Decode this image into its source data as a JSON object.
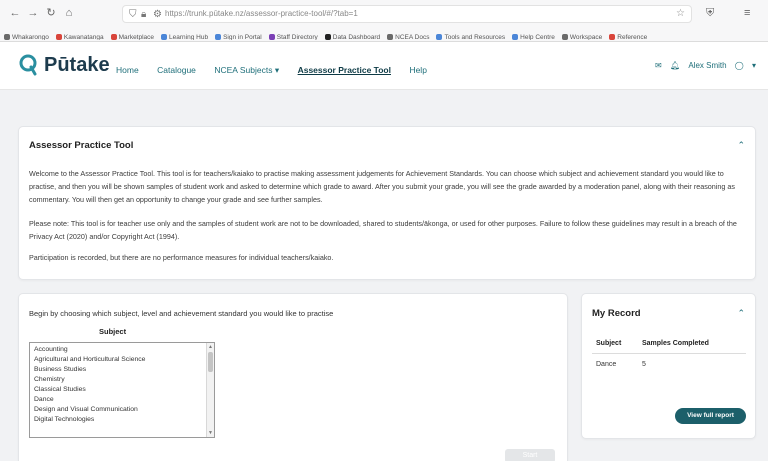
{
  "browser": {
    "url": "https://trunk.pūtake.nz/assessor-practice-tool/#/?tab=1",
    "bookmarks": [
      {
        "label": "Whakarongo",
        "color": "#6a6a6a"
      },
      {
        "label": "Kawanatanga",
        "color": "#d9453b"
      },
      {
        "label": "Marketplace",
        "color": "#d9453b"
      },
      {
        "label": "Learning Hub",
        "color": "#4b86d8"
      },
      {
        "label": "Sign in Portal",
        "color": "#4b86d8"
      },
      {
        "label": "Staff Directory",
        "color": "#7b3fb5"
      },
      {
        "label": "Data Dashboard",
        "color": "#222222"
      },
      {
        "label": "NCEA Docs",
        "color": "#6a6a6a"
      },
      {
        "label": "Tools and Resources",
        "color": "#4b86d8"
      },
      {
        "label": "Help Centre",
        "color": "#4b86d8"
      },
      {
        "label": "Workspace",
        "color": "#6a6a6a"
      },
      {
        "label": "Reference",
        "color": "#d9453b"
      }
    ]
  },
  "app": {
    "brand": "Pūtake",
    "nav": [
      "Home",
      "Catalogue",
      "NCEA Subjects",
      "Assessor Practice Tool",
      "Help"
    ],
    "nav_dropdown_glyph": "▾",
    "user_name": "Alex Smith",
    "accent": "#1f6f7a"
  },
  "intro": {
    "title": "Assessor Practice Tool",
    "paragraphs": [
      "Welcome to the Assessor Practice Tool. This tool is for teachers/kaiako to practise making assessment judgements for Achievement Standards. You can choose which subject and achievement standard you would like to practise, and then you will be shown samples of student work and asked to determine which grade to award. After you submit your grade, you will see the grade awarded by a moderation panel, along with their reasoning as commentary. You will then get an opportunity to change your grade and see further samples.",
      "Please note: This tool is for teacher use only and the samples of student work are not to be downloaded, shared to students/ākonga, or used for other purposes. Failure to follow these guidelines may result in a breach of the Privacy Act (2020) and/or Copyright Act (1994).",
      "Participation is recorded, but there are no performance measures for individual teachers/kaiako."
    ]
  },
  "selection": {
    "prompt": "Begin by choosing which subject, level and achievement standard you would like to practise",
    "subject_label": "Subject",
    "subjects": [
      "Accounting",
      "Agricultural and Horticultural Science",
      "Business Studies",
      "Chemistry",
      "Classical Studies",
      "Dance",
      "Design and Visual Communication",
      "Digital Technologies"
    ],
    "start_label": "Start"
  },
  "record": {
    "title": "My Record",
    "col_subject": "Subject",
    "col_samples": "Samples Completed",
    "rows": [
      {
        "subject": "Dance",
        "samples": "5"
      }
    ],
    "view_label": "View full report"
  }
}
